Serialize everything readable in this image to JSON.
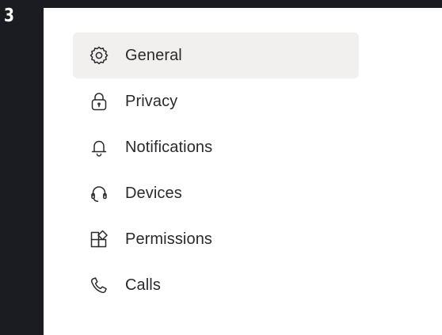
{
  "step": {
    "number": "3"
  },
  "settings_menu": {
    "items": [
      {
        "label": "General",
        "icon": "gear-icon",
        "active": true
      },
      {
        "label": "Privacy",
        "icon": "lock-icon",
        "active": false
      },
      {
        "label": "Notifications",
        "icon": "bell-icon",
        "active": false
      },
      {
        "label": "Devices",
        "icon": "headset-icon",
        "active": false
      },
      {
        "label": "Permissions",
        "icon": "apps-grid-icon",
        "active": false
      },
      {
        "label": "Calls",
        "icon": "phone-icon",
        "active": false
      }
    ]
  },
  "colors": {
    "frame_background": "#1b1b22",
    "panel_background": "#ffffff",
    "active_item_background": "#f1f0ee",
    "text": "#2a2a2e"
  }
}
